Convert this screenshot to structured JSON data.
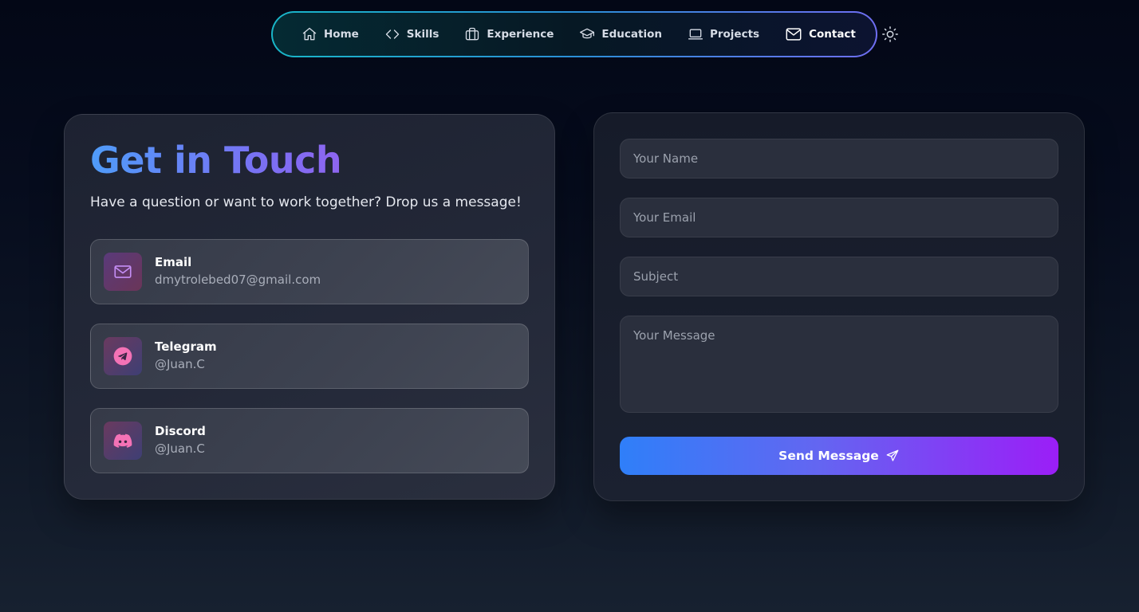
{
  "nav": {
    "items": [
      {
        "label": "Home",
        "icon": "home-icon"
      },
      {
        "label": "Skills",
        "icon": "code-icon"
      },
      {
        "label": "Experience",
        "icon": "briefcase-icon"
      },
      {
        "label": "Education",
        "icon": "graduation-cap-icon"
      },
      {
        "label": "Projects",
        "icon": "laptop-icon"
      },
      {
        "label": "Contact",
        "icon": "mail-icon",
        "active": true
      }
    ],
    "theme_toggle_icon": "sun-icon"
  },
  "contact_info": {
    "title": "Get in Touch",
    "subtitle": "Have a question or want to work together? Drop us a message!",
    "items": [
      {
        "label": "Email",
        "value": "dmytrolebed07@gmail.com",
        "icon": "mail-icon"
      },
      {
        "label": "Telegram",
        "value": "@Juan.C",
        "icon": "telegram-icon"
      },
      {
        "label": "Discord",
        "value": "@Juan.C",
        "icon": "discord-icon"
      }
    ]
  },
  "form": {
    "name_placeholder": "Your Name",
    "email_placeholder": "Your Email",
    "subject_placeholder": "Subject",
    "message_placeholder": "Your Message",
    "submit_label": "Send Message",
    "submit_icon": "send-icon"
  },
  "colors": {
    "title_gradient_start": "#4f9cf9",
    "title_gradient_end": "#8e65f0",
    "button_gradient_start": "#2f7ff9",
    "button_gradient_end": "#9b1ef7",
    "nav_border_start": "#19b6c8",
    "nav_border_end": "#6f6ef2",
    "accent_pink": "#f472b6"
  }
}
